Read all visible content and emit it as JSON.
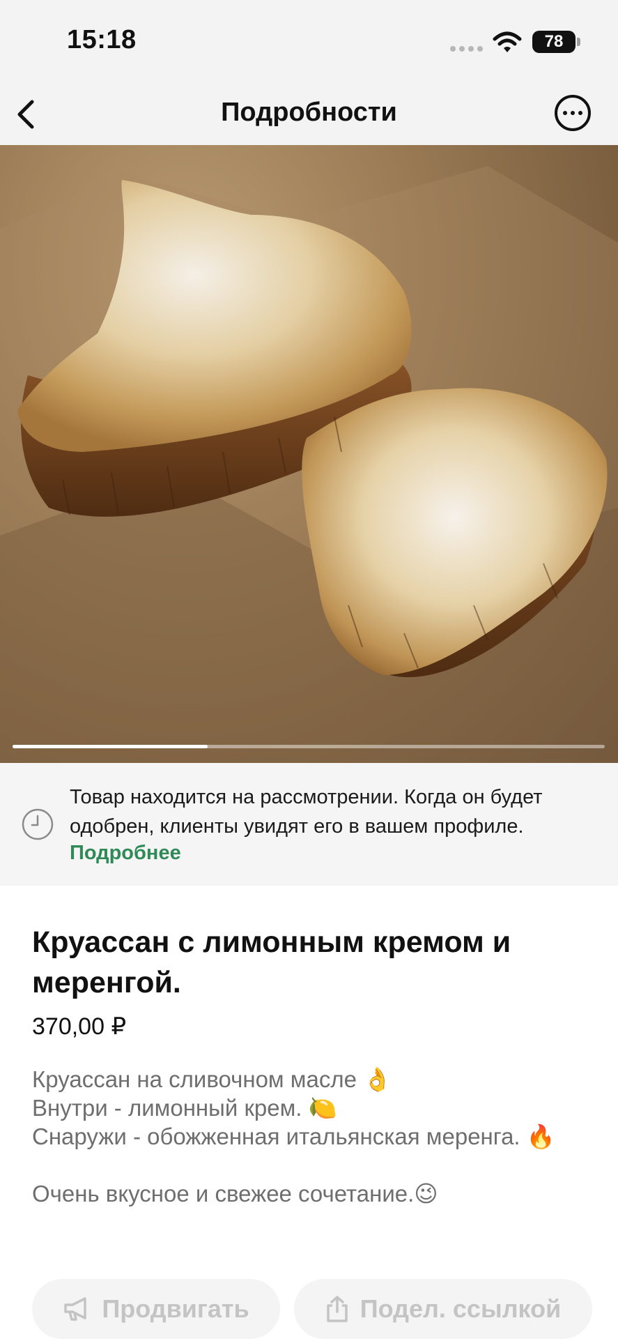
{
  "status_bar": {
    "time": "15:18",
    "battery": "78"
  },
  "nav": {
    "title": "Подробности",
    "back_icon": "chevron-left-icon",
    "more_icon": "ellipsis-circle-icon"
  },
  "gallery": {
    "current_index": 1,
    "total": 3
  },
  "review_notice": {
    "text": "Товар находится на рассмотрении. Когда он будет одобрен, клиенты увидят его в вашем профиле.",
    "link": "Подробнее",
    "icon": "clock-icon"
  },
  "product": {
    "title": "Круассан с лимонным кремом и меренгой.",
    "price": "370,00 ₽",
    "description": "Круассан на сливочном масле 👌\nВнутри - лимонный крем. 🍋\nСнаружи - обожженная итальянская меренга. 🔥\n\nОчень вкусное и свежее сочетание.😉"
  },
  "actions": {
    "promote_label": "Продвигать",
    "share_label": "Подел. ссылкой"
  },
  "colors": {
    "link_green": "#2f8a57",
    "disabled_text": "#c4c4c4",
    "background_gray": "#f3f3f3"
  }
}
